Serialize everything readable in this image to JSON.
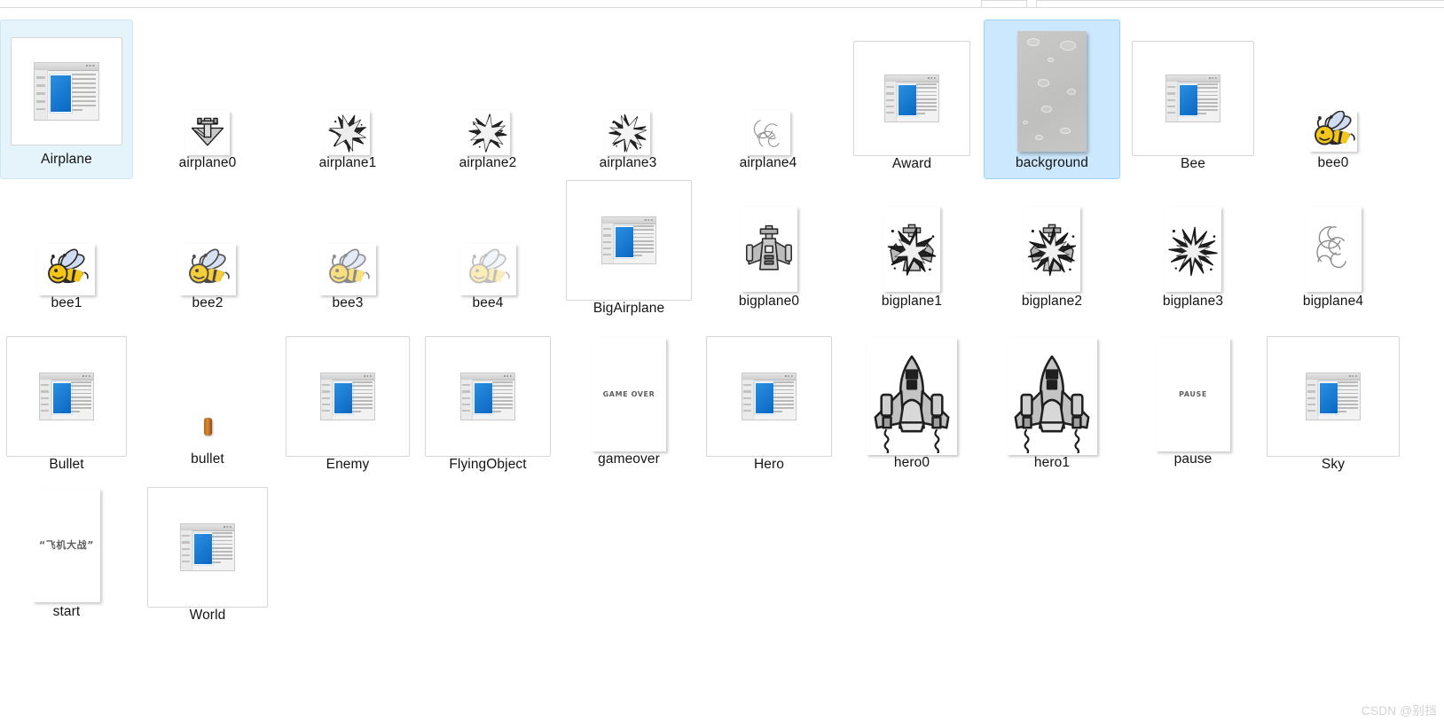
{
  "window": {
    "view_mode": "Large icons",
    "watermark": "CSDN @别挡"
  },
  "colors": {
    "selection_fill": "#cce8ff",
    "selection_border": "#99d1ff",
    "hover_fill": "#e5f3fb",
    "hover_border": "#cfe6f5",
    "label_text": "#141414",
    "thumb_border": "#d6d6d6",
    "doc_blue": "#0a67c2",
    "background_tile": "#c5c5c3",
    "bullet_brown": "#b4651b",
    "watermark_text": "#d2d2d2"
  },
  "grid": {
    "columns": 9,
    "rows": 4,
    "items": [
      {
        "name": "Airplane",
        "label": "Airplane",
        "kind": "java-class",
        "state": "hover",
        "thumb_w": 74,
        "thumb_h": 66
      },
      {
        "name": "airplane0",
        "label": "airplane0",
        "kind": "sprite-plane",
        "state": "normal",
        "thumb_w": 46,
        "thumb_h": 46
      },
      {
        "name": "airplane1",
        "label": "airplane1",
        "kind": "sprite-blast1",
        "state": "normal",
        "thumb_w": 46,
        "thumb_h": 46
      },
      {
        "name": "airplane2",
        "label": "airplane2",
        "kind": "sprite-blast2",
        "state": "normal",
        "thumb_w": 46,
        "thumb_h": 46
      },
      {
        "name": "airplane3",
        "label": "airplane3",
        "kind": "sprite-blast3",
        "state": "normal",
        "thumb_w": 46,
        "thumb_h": 46
      },
      {
        "name": "airplane4",
        "label": "airplane4",
        "kind": "sprite-smoke",
        "state": "normal",
        "thumb_w": 46,
        "thumb_h": 46
      },
      {
        "name": "Award",
        "label": "Award",
        "kind": "java-class",
        "state": "normal",
        "thumb_w": 62,
        "thumb_h": 54
      },
      {
        "name": "background",
        "label": "background",
        "kind": "bg-tile",
        "state": "selected",
        "thumb_w": 78,
        "thumb_h": 136
      },
      {
        "name": "Bee",
        "label": "Bee",
        "kind": "java-class",
        "state": "normal",
        "thumb_w": 62,
        "thumb_h": 54
      },
      {
        "name": "bee0",
        "label": "bee0",
        "kind": "sprite-bee",
        "state": "normal",
        "thumb_w": 50,
        "thumb_h": 42,
        "fade": 0.0
      },
      {
        "name": "bee1",
        "label": "bee1",
        "kind": "sprite-bee",
        "state": "normal",
        "thumb_w": 60,
        "thumb_h": 54,
        "fade": 0.0
      },
      {
        "name": "bee2",
        "label": "bee2",
        "kind": "sprite-bee",
        "state": "normal",
        "thumb_w": 60,
        "thumb_h": 54,
        "fade": 0.15
      },
      {
        "name": "bee3",
        "label": "bee3",
        "kind": "sprite-bee",
        "state": "normal",
        "thumb_w": 60,
        "thumb_h": 54,
        "fade": 0.45
      },
      {
        "name": "bee4",
        "label": "bee4",
        "kind": "sprite-bee",
        "state": "normal",
        "thumb_w": 60,
        "thumb_h": 54,
        "fade": 0.7
      },
      {
        "name": "BigAirplane",
        "label": "BigAirplane",
        "kind": "java-class",
        "state": "normal",
        "thumb_w": 62,
        "thumb_h": 54,
        "big_frame": true
      },
      {
        "name": "bigplane0",
        "label": "bigplane0",
        "kind": "sprite-bigplane",
        "state": "normal",
        "thumb_w": 60,
        "thumb_h": 92
      },
      {
        "name": "bigplane1",
        "label": "bigplane1",
        "kind": "sprite-bigblast1",
        "state": "normal",
        "thumb_w": 60,
        "thumb_h": 92
      },
      {
        "name": "bigplane2",
        "label": "bigplane2",
        "kind": "sprite-bigblast2",
        "state": "normal",
        "thumb_w": 60,
        "thumb_h": 92
      },
      {
        "name": "bigplane3",
        "label": "bigplane3",
        "kind": "sprite-bigblast3",
        "state": "normal",
        "thumb_w": 60,
        "thumb_h": 92
      },
      {
        "name": "bigplane4",
        "label": "bigplane4",
        "kind": "sprite-bigsmoke",
        "state": "normal",
        "thumb_w": 60,
        "thumb_h": 92
      },
      {
        "name": "Bullet",
        "label": "Bullet",
        "kind": "java-class",
        "state": "normal",
        "thumb_w": 62,
        "thumb_h": 54,
        "big_frame": true
      },
      {
        "name": "bullet",
        "label": "bullet",
        "kind": "sprite-bullet",
        "state": "normal",
        "thumb_w": 9,
        "thumb_h": 20
      },
      {
        "name": "Enemy",
        "label": "Enemy",
        "kind": "java-class",
        "state": "normal",
        "thumb_w": 62,
        "thumb_h": 54,
        "big_frame": true
      },
      {
        "name": "FlyingObject",
        "label": "FlyingObject",
        "kind": "java-class",
        "state": "normal",
        "thumb_w": 62,
        "thumb_h": 54,
        "big_frame": true
      },
      {
        "name": "gameover",
        "label": "gameover",
        "kind": "sheet-text",
        "state": "normal",
        "thumb_w": 84,
        "thumb_h": 128,
        "sheet_text": "GAME OVER",
        "sheet_font": 8
      },
      {
        "name": "Hero",
        "label": "Hero",
        "kind": "java-class",
        "state": "normal",
        "thumb_w": 62,
        "thumb_h": 54,
        "big_frame": true
      },
      {
        "name": "hero0",
        "label": "hero0",
        "kind": "sprite-hero",
        "state": "normal",
        "thumb_w": 98,
        "thumb_h": 128
      },
      {
        "name": "hero1",
        "label": "hero1",
        "kind": "sprite-hero",
        "state": "normal",
        "thumb_w": 98,
        "thumb_h": 128
      },
      {
        "name": "pause",
        "label": "pause",
        "kind": "sheet-text",
        "state": "normal",
        "thumb_w": 84,
        "thumb_h": 128,
        "sheet_text": "PAUSE",
        "sheet_font": 8
      },
      {
        "name": "Sky",
        "label": "Sky",
        "kind": "java-class",
        "state": "normal",
        "thumb_w": 62,
        "thumb_h": 54,
        "big_frame": true
      },
      {
        "name": "start",
        "label": "start",
        "kind": "sheet-text",
        "state": "normal",
        "thumb_w": 76,
        "thumb_h": 128,
        "sheet_text": "“飞机大战”",
        "sheet_font": 11
      },
      {
        "name": "World",
        "label": "World",
        "kind": "java-class",
        "state": "normal",
        "thumb_w": 62,
        "thumb_h": 54,
        "big_frame": true
      }
    ]
  }
}
